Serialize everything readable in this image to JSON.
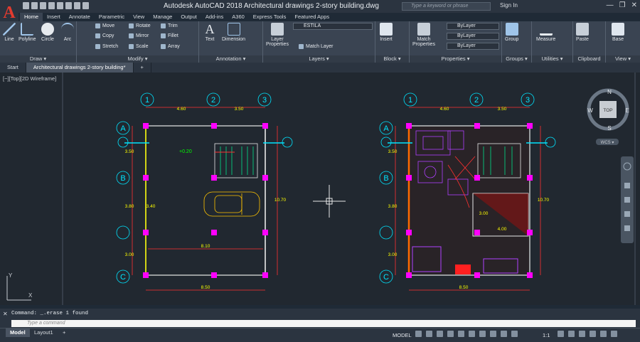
{
  "app": {
    "title": "Autodesk AutoCAD 2018    Architectural drawings 2-story building.dwg",
    "search_placeholder": "Type a keyword or phrase",
    "sign_in": "Sign In"
  },
  "ribbon_tabs": [
    "Home",
    "Insert",
    "Annotate",
    "Parametric",
    "View",
    "Manage",
    "Output",
    "Add-ins",
    "A360",
    "Express Tools",
    "Featured Apps"
  ],
  "panels": {
    "draw": {
      "label": "Draw ▾",
      "tools": [
        "Line",
        "Polyline",
        "Circle",
        "Arc"
      ]
    },
    "modify": {
      "label": "Modify ▾",
      "rows": [
        [
          "Move",
          "Rotate",
          "Trim"
        ],
        [
          "Copy",
          "Mirror",
          "Fillet"
        ],
        [
          "Stretch",
          "Scale",
          "Array"
        ]
      ]
    },
    "annotation": {
      "label": "Annotation ▾",
      "tools": [
        "Text",
        "Dimension"
      ]
    },
    "layers": {
      "label": "Layers ▾",
      "layer_properties": "Layer Properties",
      "current_layer": "ESTILA",
      "match_layer": "Match Layer"
    },
    "block": {
      "label": "Block ▾",
      "insert": "Insert"
    },
    "properties": {
      "label": "Properties ▾",
      "match": "Match Properties",
      "bylayer": [
        "ByLayer",
        "ByLayer",
        "ByLayer"
      ]
    },
    "groups": {
      "label": "Groups ▾",
      "group": "Group"
    },
    "utilities": {
      "label": "Utilities ▾",
      "measure": "Measure"
    },
    "clipboard": {
      "label": "Clipboard",
      "paste": "Paste"
    },
    "view": {
      "label": "View ▾",
      "base": "Base"
    }
  },
  "doc_tabs": [
    "Start",
    "Architectural drawings 2-story building*"
  ],
  "viewport_label": "[−][Top][2D Wireframe]",
  "viewcube": {
    "top": "TOP",
    "n": "N",
    "s": "S",
    "e": "E",
    "w": "W",
    "wcs": "WCS ▾"
  },
  "plans": {
    "col_labels": [
      "1",
      "2",
      "3"
    ],
    "row_labels": [
      "A",
      "B",
      "C"
    ],
    "dims_top": [
      "4.60",
      "3.50"
    ],
    "dims_bottom": "8.50",
    "dims_inner": "8.10",
    "dims_left": [
      "3.50",
      "3.80",
      "3.00"
    ],
    "dims_right": "10.70",
    "inner_left": "3.40",
    "level": "+0.20",
    "room_dims": [
      "3.00",
      "4.00"
    ]
  },
  "command": {
    "history": "Command:  _.erase 1 found",
    "placeholder": "Type a command"
  },
  "layout_tabs": [
    "Model",
    "Layout1"
  ],
  "status": {
    "model": "MODEL",
    "scale": "1:1"
  },
  "colors": {
    "magenta": "#ff00ff",
    "yellow": "#ffff00",
    "cyan": "#00e5ff",
    "red": "#ff3030",
    "white": "#e8e8e8",
    "bg": "#212830"
  }
}
